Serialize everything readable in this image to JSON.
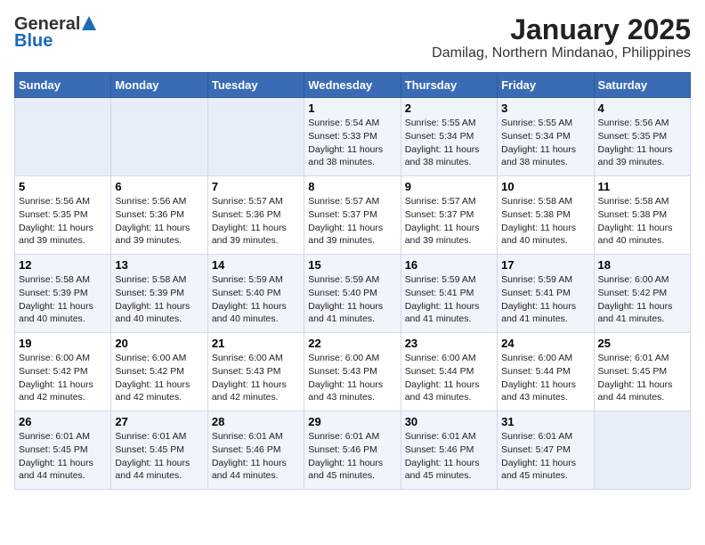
{
  "logo": {
    "general": "General",
    "blue": "Blue"
  },
  "title": "January 2025",
  "subtitle": "Damilag, Northern Mindanao, Philippines",
  "headers": [
    "Sunday",
    "Monday",
    "Tuesday",
    "Wednesday",
    "Thursday",
    "Friday",
    "Saturday"
  ],
  "weeks": [
    [
      {
        "day": "",
        "info": ""
      },
      {
        "day": "",
        "info": ""
      },
      {
        "day": "",
        "info": ""
      },
      {
        "day": "1",
        "info": "Sunrise: 5:54 AM\nSunset: 5:33 PM\nDaylight: 11 hours\nand 38 minutes."
      },
      {
        "day": "2",
        "info": "Sunrise: 5:55 AM\nSunset: 5:34 PM\nDaylight: 11 hours\nand 38 minutes."
      },
      {
        "day": "3",
        "info": "Sunrise: 5:55 AM\nSunset: 5:34 PM\nDaylight: 11 hours\nand 38 minutes."
      },
      {
        "day": "4",
        "info": "Sunrise: 5:56 AM\nSunset: 5:35 PM\nDaylight: 11 hours\nand 39 minutes."
      }
    ],
    [
      {
        "day": "5",
        "info": "Sunrise: 5:56 AM\nSunset: 5:35 PM\nDaylight: 11 hours\nand 39 minutes."
      },
      {
        "day": "6",
        "info": "Sunrise: 5:56 AM\nSunset: 5:36 PM\nDaylight: 11 hours\nand 39 minutes."
      },
      {
        "day": "7",
        "info": "Sunrise: 5:57 AM\nSunset: 5:36 PM\nDaylight: 11 hours\nand 39 minutes."
      },
      {
        "day": "8",
        "info": "Sunrise: 5:57 AM\nSunset: 5:37 PM\nDaylight: 11 hours\nand 39 minutes."
      },
      {
        "day": "9",
        "info": "Sunrise: 5:57 AM\nSunset: 5:37 PM\nDaylight: 11 hours\nand 39 minutes."
      },
      {
        "day": "10",
        "info": "Sunrise: 5:58 AM\nSunset: 5:38 PM\nDaylight: 11 hours\nand 40 minutes."
      },
      {
        "day": "11",
        "info": "Sunrise: 5:58 AM\nSunset: 5:38 PM\nDaylight: 11 hours\nand 40 minutes."
      }
    ],
    [
      {
        "day": "12",
        "info": "Sunrise: 5:58 AM\nSunset: 5:39 PM\nDaylight: 11 hours\nand 40 minutes."
      },
      {
        "day": "13",
        "info": "Sunrise: 5:58 AM\nSunset: 5:39 PM\nDaylight: 11 hours\nand 40 minutes."
      },
      {
        "day": "14",
        "info": "Sunrise: 5:59 AM\nSunset: 5:40 PM\nDaylight: 11 hours\nand 40 minutes."
      },
      {
        "day": "15",
        "info": "Sunrise: 5:59 AM\nSunset: 5:40 PM\nDaylight: 11 hours\nand 41 minutes."
      },
      {
        "day": "16",
        "info": "Sunrise: 5:59 AM\nSunset: 5:41 PM\nDaylight: 11 hours\nand 41 minutes."
      },
      {
        "day": "17",
        "info": "Sunrise: 5:59 AM\nSunset: 5:41 PM\nDaylight: 11 hours\nand 41 minutes."
      },
      {
        "day": "18",
        "info": "Sunrise: 6:00 AM\nSunset: 5:42 PM\nDaylight: 11 hours\nand 41 minutes."
      }
    ],
    [
      {
        "day": "19",
        "info": "Sunrise: 6:00 AM\nSunset: 5:42 PM\nDaylight: 11 hours\nand 42 minutes."
      },
      {
        "day": "20",
        "info": "Sunrise: 6:00 AM\nSunset: 5:42 PM\nDaylight: 11 hours\nand 42 minutes."
      },
      {
        "day": "21",
        "info": "Sunrise: 6:00 AM\nSunset: 5:43 PM\nDaylight: 11 hours\nand 42 minutes."
      },
      {
        "day": "22",
        "info": "Sunrise: 6:00 AM\nSunset: 5:43 PM\nDaylight: 11 hours\nand 43 minutes."
      },
      {
        "day": "23",
        "info": "Sunrise: 6:00 AM\nSunset: 5:44 PM\nDaylight: 11 hours\nand 43 minutes."
      },
      {
        "day": "24",
        "info": "Sunrise: 6:00 AM\nSunset: 5:44 PM\nDaylight: 11 hours\nand 43 minutes."
      },
      {
        "day": "25",
        "info": "Sunrise: 6:01 AM\nSunset: 5:45 PM\nDaylight: 11 hours\nand 44 minutes."
      }
    ],
    [
      {
        "day": "26",
        "info": "Sunrise: 6:01 AM\nSunset: 5:45 PM\nDaylight: 11 hours\nand 44 minutes."
      },
      {
        "day": "27",
        "info": "Sunrise: 6:01 AM\nSunset: 5:45 PM\nDaylight: 11 hours\nand 44 minutes."
      },
      {
        "day": "28",
        "info": "Sunrise: 6:01 AM\nSunset: 5:46 PM\nDaylight: 11 hours\nand 44 minutes."
      },
      {
        "day": "29",
        "info": "Sunrise: 6:01 AM\nSunset: 5:46 PM\nDaylight: 11 hours\nand 45 minutes."
      },
      {
        "day": "30",
        "info": "Sunrise: 6:01 AM\nSunset: 5:46 PM\nDaylight: 11 hours\nand 45 minutes."
      },
      {
        "day": "31",
        "info": "Sunrise: 6:01 AM\nSunset: 5:47 PM\nDaylight: 11 hours\nand 45 minutes."
      },
      {
        "day": "",
        "info": ""
      }
    ]
  ]
}
